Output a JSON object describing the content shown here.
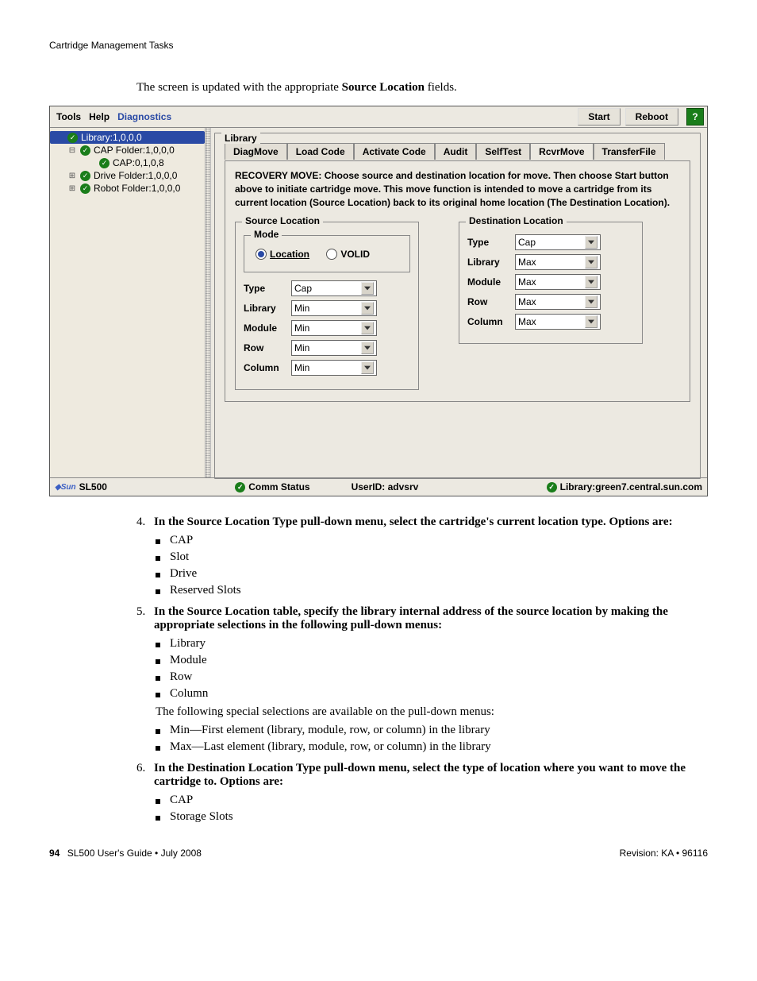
{
  "running_head": "Cartridge Management Tasks",
  "caption_prefix": "The screen is updated with the appropriate ",
  "caption_bold": "Source Location",
  "caption_suffix": " fields.",
  "shot": {
    "menus": [
      "Tools",
      "Help",
      "Diagnostics"
    ],
    "diag_color": "#2a4aa5",
    "buttons": {
      "start": "Start",
      "reboot": "Reboot"
    },
    "tree": [
      {
        "indent": "pad1",
        "twist": "",
        "label": "Library:1,0,0,0",
        "sel": true
      },
      {
        "indent": "pad2",
        "twist": "⊟",
        "label": "CAP Folder:1,0,0,0"
      },
      {
        "indent": "pad3",
        "twist": "",
        "label": "CAP:0,1,0,8"
      },
      {
        "indent": "pad2",
        "twist": "⊞",
        "label": "Drive Folder:1,0,0,0"
      },
      {
        "indent": "pad2",
        "twist": "⊞",
        "label": "Robot Folder:1,0,0,0"
      }
    ],
    "frame_title": "Library",
    "tabs": [
      "DiagMove",
      "Load Code",
      "Activate Code",
      "Audit",
      "SelfTest",
      "RcvrMove",
      "TransferFile"
    ],
    "active_tab": "RcvrMove",
    "instructions": "RECOVERY MOVE: Choose source and destination location for move. Then choose Start button above to initiate cartridge move. This move function is intended to move a cartridge from its current location (Source Location) back to its original home location (The Destination Location).",
    "source": {
      "legend": "Source Location",
      "mode_legend": "Mode",
      "mode_opts": {
        "location": "Location",
        "volid": "VOLID"
      },
      "rows": [
        {
          "label": "Type",
          "value": "Cap"
        },
        {
          "label": "Library",
          "value": "Min"
        },
        {
          "label": "Module",
          "value": "Min"
        },
        {
          "label": "Row",
          "value": "Min"
        },
        {
          "label": "Column",
          "value": "Min"
        }
      ]
    },
    "dest": {
      "legend": "Destination Location",
      "rows": [
        {
          "label": "Type",
          "value": "Cap"
        },
        {
          "label": "Library",
          "value": "Max"
        },
        {
          "label": "Module",
          "value": "Max"
        },
        {
          "label": "Row",
          "value": "Max"
        },
        {
          "label": "Column",
          "value": "Max"
        }
      ]
    },
    "status": {
      "brand": "◆Sun",
      "model": "SL500",
      "comm": "Comm Status",
      "user": "UserID: advsrv",
      "lib": "Library:green7.central.sun.com"
    }
  },
  "steps": [
    {
      "num": "4.",
      "text": "In the Source Location Type pull-down menu, select the cartridge's current location type. Options are:",
      "bullets": [
        "CAP",
        "Slot",
        "Drive",
        "Reserved Slots"
      ]
    },
    {
      "num": "5.",
      "text": "In the Source Location table, specify the library internal address of the source location by making the appropriate selections in the following pull-down menus:",
      "bullets": [
        "Library",
        "Module",
        "Row",
        "Column"
      ],
      "note": "The following special selections are available on the pull-down menus:",
      "bullets2": [
        "Min—First element (library, module, row, or column) in the library",
        "Max—Last element (library, module, row, or column) in the library"
      ]
    },
    {
      "num": "6.",
      "text": "In the Destination Location Type pull-down menu, select the type of location where you want to move the cartridge to. Options are:",
      "bullets": [
        "CAP",
        "Storage Slots"
      ]
    }
  ],
  "footer": {
    "page": "94",
    "title": "SL500 User's Guide  •  July 2008",
    "rev": "Revision: KA  •  96116"
  }
}
